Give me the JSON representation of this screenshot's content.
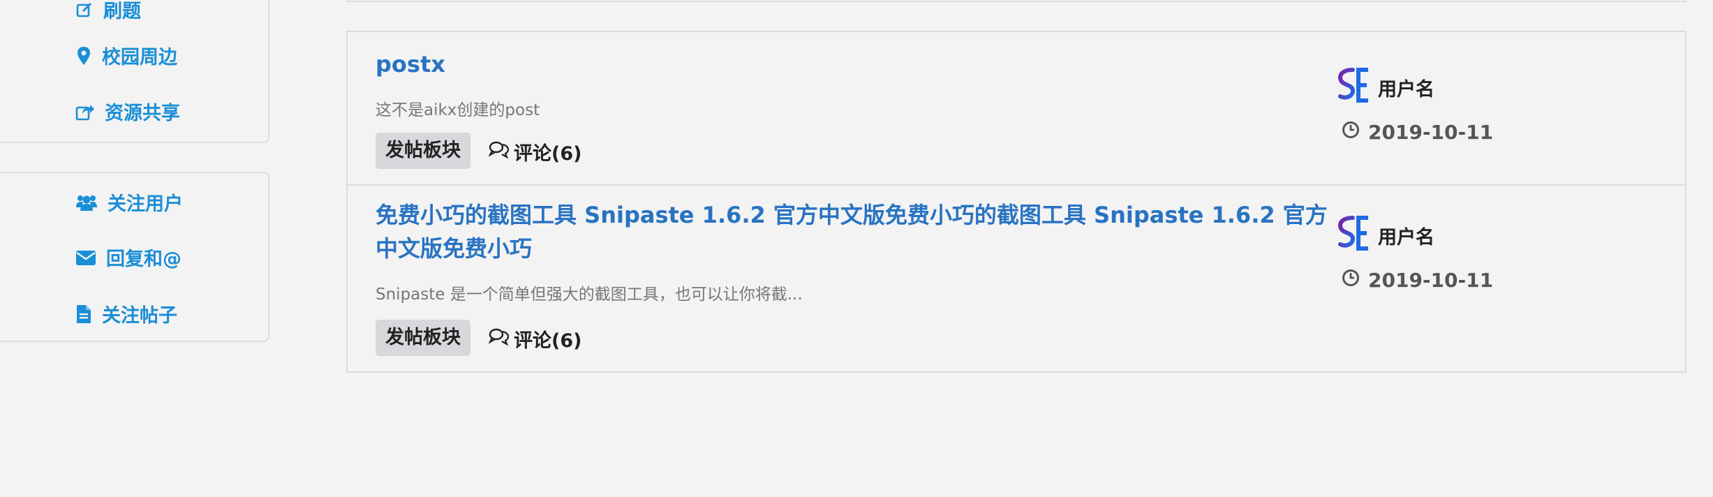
{
  "sidebar": {
    "group1": [
      {
        "label": "刷题",
        "icon": "edit-icon"
      },
      {
        "label": "校园周边",
        "icon": "map-marker-icon"
      },
      {
        "label": "资源共享",
        "icon": "share-icon"
      }
    ],
    "group2": [
      {
        "label": "关注用户",
        "icon": "users-icon"
      },
      {
        "label": "回复和@",
        "icon": "envelope-icon"
      },
      {
        "label": "关注帖子",
        "icon": "file-icon"
      }
    ]
  },
  "posts": [
    {
      "title": "postx",
      "excerpt": "这不是aikx创建的post",
      "tag": "发帖板块",
      "comments": "评论(6)",
      "username": "用户名",
      "date": "2019-10-11"
    },
    {
      "title": "免费小巧的截图工具 Snipaste 1.6.2 官方中文版免费小巧的截图工具 Snipaste 1.6.2 官方中文版免费小巧",
      "excerpt": "Snipaste 是一个简单但强大的截图工具，也可以让你将截...",
      "tag": "发帖板块",
      "comments": "评论(6)",
      "username": "用户名",
      "date": "2019-10-11"
    }
  ],
  "colors": {
    "link": "#1a8fd6",
    "title": "#2873c2",
    "background": "#f3f3f3",
    "border": "#dcdcdc",
    "tag_background": "#d6d8dc"
  }
}
